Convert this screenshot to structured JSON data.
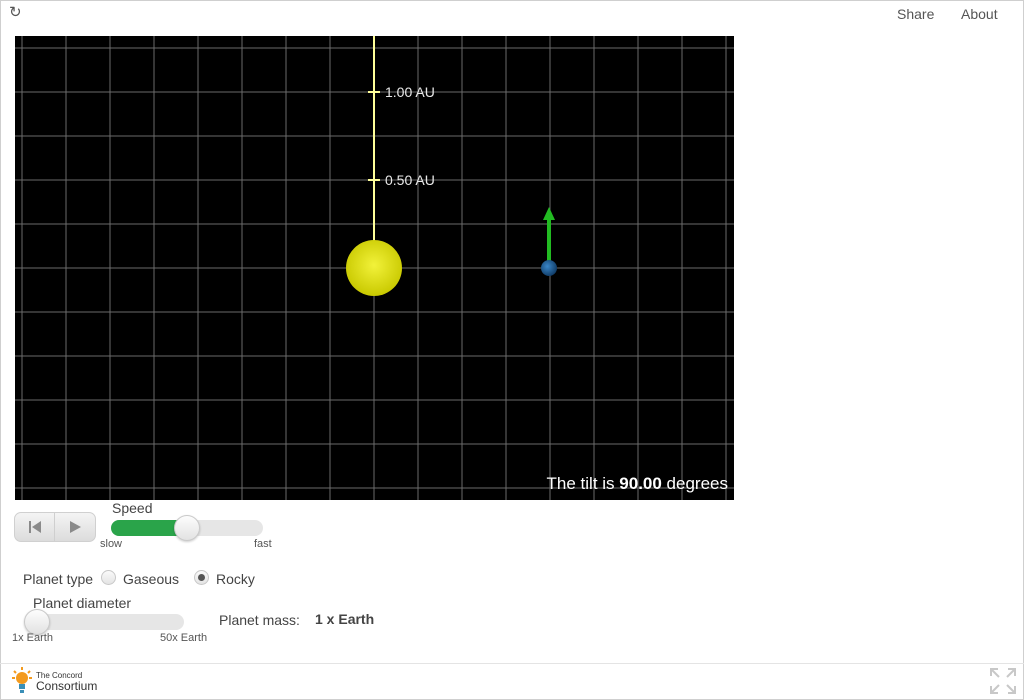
{
  "header": {
    "share_label": "Share",
    "about_label": "About"
  },
  "simulation": {
    "distance_labels": [
      "1.00 AU",
      "0.50 AU"
    ],
    "tilt_prefix": "The tilt is ",
    "tilt_value": "90.00",
    "tilt_suffix": " degrees",
    "colors": {
      "background": "#000000",
      "grid": "#6a6a6a",
      "sun": "#e6e60a",
      "axis_line": "#ffff99",
      "planet": "#1f5e99",
      "arrow": "#22bb22"
    }
  },
  "controls": {
    "speed": {
      "label": "Speed",
      "min_label": "slow",
      "max_label": "fast",
      "value": 0.5
    },
    "planet_type": {
      "label": "Planet type",
      "options": [
        "Gaseous",
        "Rocky"
      ],
      "selected": "Rocky"
    },
    "planet_diameter": {
      "label": "Planet diameter",
      "min_label": "1x Earth",
      "max_label": "50x Earth",
      "value": 0
    },
    "planet_mass": {
      "label": "Planet mass:",
      "value": "1 x Earth"
    }
  },
  "footer": {
    "logo_line1": "The Concord",
    "logo_line2": "Consortium"
  }
}
